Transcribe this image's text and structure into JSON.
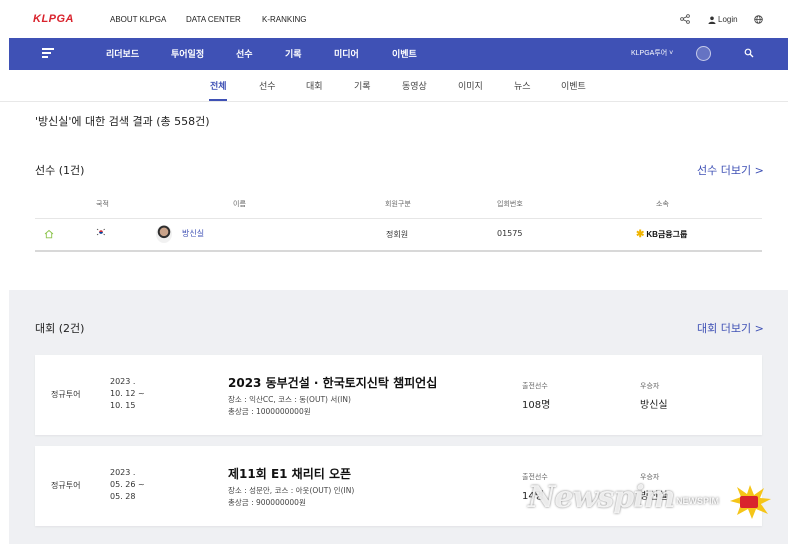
{
  "topbar": {
    "logo": "KLPGA",
    "nav": [
      "ABOUT KLPGA",
      "DATA CENTER",
      "K-RANKING"
    ],
    "login": "Login"
  },
  "menubar": {
    "items": [
      "리더보드",
      "투어일정",
      "선수",
      "기록",
      "미디어",
      "이벤트"
    ],
    "tour_select": "KLPGA투어 ˅"
  },
  "subtabs": [
    "전체",
    "선수",
    "대회",
    "기록",
    "동영상",
    "이미지",
    "뉴스",
    "이벤트"
  ],
  "result_title": "'방신실'에 대한 검색 결과 (총 558건)",
  "players": {
    "heading": "선수 (1건)",
    "more": "선수 더보기 >",
    "columns": [
      "국적",
      "이름",
      "회원구분",
      "입회번호",
      "소속"
    ],
    "rows": [
      {
        "name": "방신실",
        "member_type": "정회원",
        "member_no": "01575",
        "sponsor": "KB금융그룹"
      }
    ]
  },
  "tournaments": {
    "heading": "대회 (2건)",
    "more": "대회 더보기 >",
    "entrants_label": "출전선수",
    "winner_label": "우승자",
    "items": [
      {
        "tour": "정규투어",
        "date_lines": [
          "2023 .",
          "10. 12 ~",
          "10. 15"
        ],
        "name": "2023 동부건설 · 한국토지신탁 챔피언십",
        "venue": "장소 : 익산CC, 코스 : 동(OUT) 서(IN)",
        "prize": "총상금 : 1000000000원",
        "entrants": "108명",
        "winner": "방신실"
      },
      {
        "tour": "정규투어",
        "date_lines": [
          "2023 .",
          "05. 26 ~",
          "05. 28"
        ],
        "name": "제11회 E1 채리티 오픈",
        "venue": "장소 : 성문안, 코스 : 아웃(OUT) 인(IN)",
        "prize": "총상금 : 900000000원",
        "entrants": "14명",
        "winner": "방신실"
      }
    ]
  },
  "watermark": {
    "main": "Newspim",
    "small": "NEWSPIM"
  },
  "colors": {
    "brand_blue": "#3f51b5",
    "logo_red": "#d9232d",
    "section_bg": "#eff0f3"
  }
}
